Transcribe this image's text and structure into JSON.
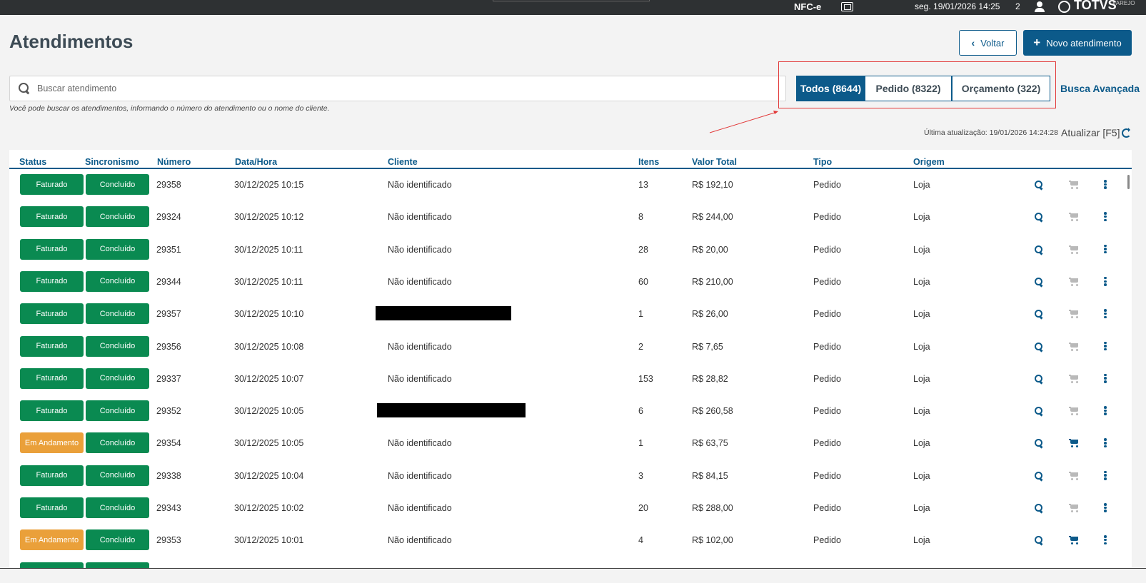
{
  "topbar": {
    "nfce": "NFC-e",
    "datetime": "seg. 19/01/2026 14:25",
    "count": "2",
    "logo": "TOTVS",
    "logo_sub": "VAREJO"
  },
  "page": {
    "title": "Atendimentos",
    "back_label": "Voltar",
    "new_label": "Novo atendimento"
  },
  "search": {
    "placeholder": "Buscar atendimento",
    "hint": "Você pode buscar os atendimentos, informando o número do atendimento ou o nome do cliente."
  },
  "filters": {
    "todos": "Todos (8644)",
    "pedido": "Pedido (8322)",
    "orcamento": "Orçamento (322)",
    "busca_avancada": "Busca Avançada"
  },
  "update": {
    "last": "Última atualização: 19/01/2026 14:24:28",
    "refresh_label": "Atualizar [F5]"
  },
  "colors": {
    "primary": "#0c5a8a",
    "success": "#0a8a51",
    "warning": "#eaa03a",
    "highlight": "#e23a3a"
  },
  "table": {
    "headers": [
      "Status",
      "Sincronismo",
      "Número",
      "Data/Hora",
      "Cliente",
      "Itens",
      "Valor Total",
      "Tipo",
      "Origem"
    ],
    "rows": [
      {
        "status": "Faturado",
        "sync": "Concluído",
        "numero": "29358",
        "data": "30/12/2025 10:15",
        "cliente": "Não identificado",
        "itens": "13",
        "valor": "R$ 192,10",
        "tipo": "Pedido",
        "origem": "Loja"
      },
      {
        "status": "Faturado",
        "sync": "Concluído",
        "numero": "29324",
        "data": "30/12/2025 10:12",
        "cliente": "Não identificado",
        "itens": "8",
        "valor": "R$ 244,00",
        "tipo": "Pedido",
        "origem": "Loja"
      },
      {
        "status": "Faturado",
        "sync": "Concluído",
        "numero": "29351",
        "data": "30/12/2025 10:11",
        "cliente": "Não identificado",
        "itens": "28",
        "valor": "R$ 20,00",
        "tipo": "Pedido",
        "origem": "Loja"
      },
      {
        "status": "Faturado",
        "sync": "Concluído",
        "numero": "29344",
        "data": "30/12/2025 10:11",
        "cliente": "Não identificado",
        "itens": "60",
        "valor": "R$ 210,00",
        "tipo": "Pedido",
        "origem": "Loja"
      },
      {
        "status": "Faturado",
        "sync": "Concluído",
        "numero": "29357",
        "data": "30/12/2025 10:10",
        "cliente": "",
        "itens": "1",
        "valor": "R$ 26,00",
        "tipo": "Pedido",
        "origem": "Loja"
      },
      {
        "status": "Faturado",
        "sync": "Concluído",
        "numero": "29356",
        "data": "30/12/2025 10:08",
        "cliente": "Não identificado",
        "itens": "2",
        "valor": "R$ 7,65",
        "tipo": "Pedido",
        "origem": "Loja"
      },
      {
        "status": "Faturado",
        "sync": "Concluído",
        "numero": "29337",
        "data": "30/12/2025 10:07",
        "cliente": "Não identificado",
        "itens": "153",
        "valor": "R$ 28,82",
        "tipo": "Pedido",
        "origem": "Loja"
      },
      {
        "status": "Faturado",
        "sync": "Concluído",
        "numero": "29352",
        "data": "30/12/2025 10:05",
        "cliente": "",
        "itens": "6",
        "valor": "R$ 260,58",
        "tipo": "Pedido",
        "origem": "Loja"
      },
      {
        "status": "Em Andamento",
        "sync": "Concluído",
        "numero": "29354",
        "data": "30/12/2025 10:05",
        "cliente": "Não identificado",
        "itens": "1",
        "valor": "R$ 63,75",
        "tipo": "Pedido",
        "origem": "Loja"
      },
      {
        "status": "Faturado",
        "sync": "Concluído",
        "numero": "29338",
        "data": "30/12/2025 10:04",
        "cliente": "Não identificado",
        "itens": "3",
        "valor": "R$ 84,15",
        "tipo": "Pedido",
        "origem": "Loja"
      },
      {
        "status": "Faturado",
        "sync": "Concluído",
        "numero": "29343",
        "data": "30/12/2025 10:02",
        "cliente": "Não identificado",
        "itens": "20",
        "valor": "R$ 288,00",
        "tipo": "Pedido",
        "origem": "Loja"
      },
      {
        "status": "Em Andamento",
        "sync": "Concluído",
        "numero": "29353",
        "data": "30/12/2025 10:01",
        "cliente": "Não identificado",
        "itens": "4",
        "valor": "R$ 102,00",
        "tipo": "Pedido",
        "origem": "Loja"
      }
    ]
  }
}
